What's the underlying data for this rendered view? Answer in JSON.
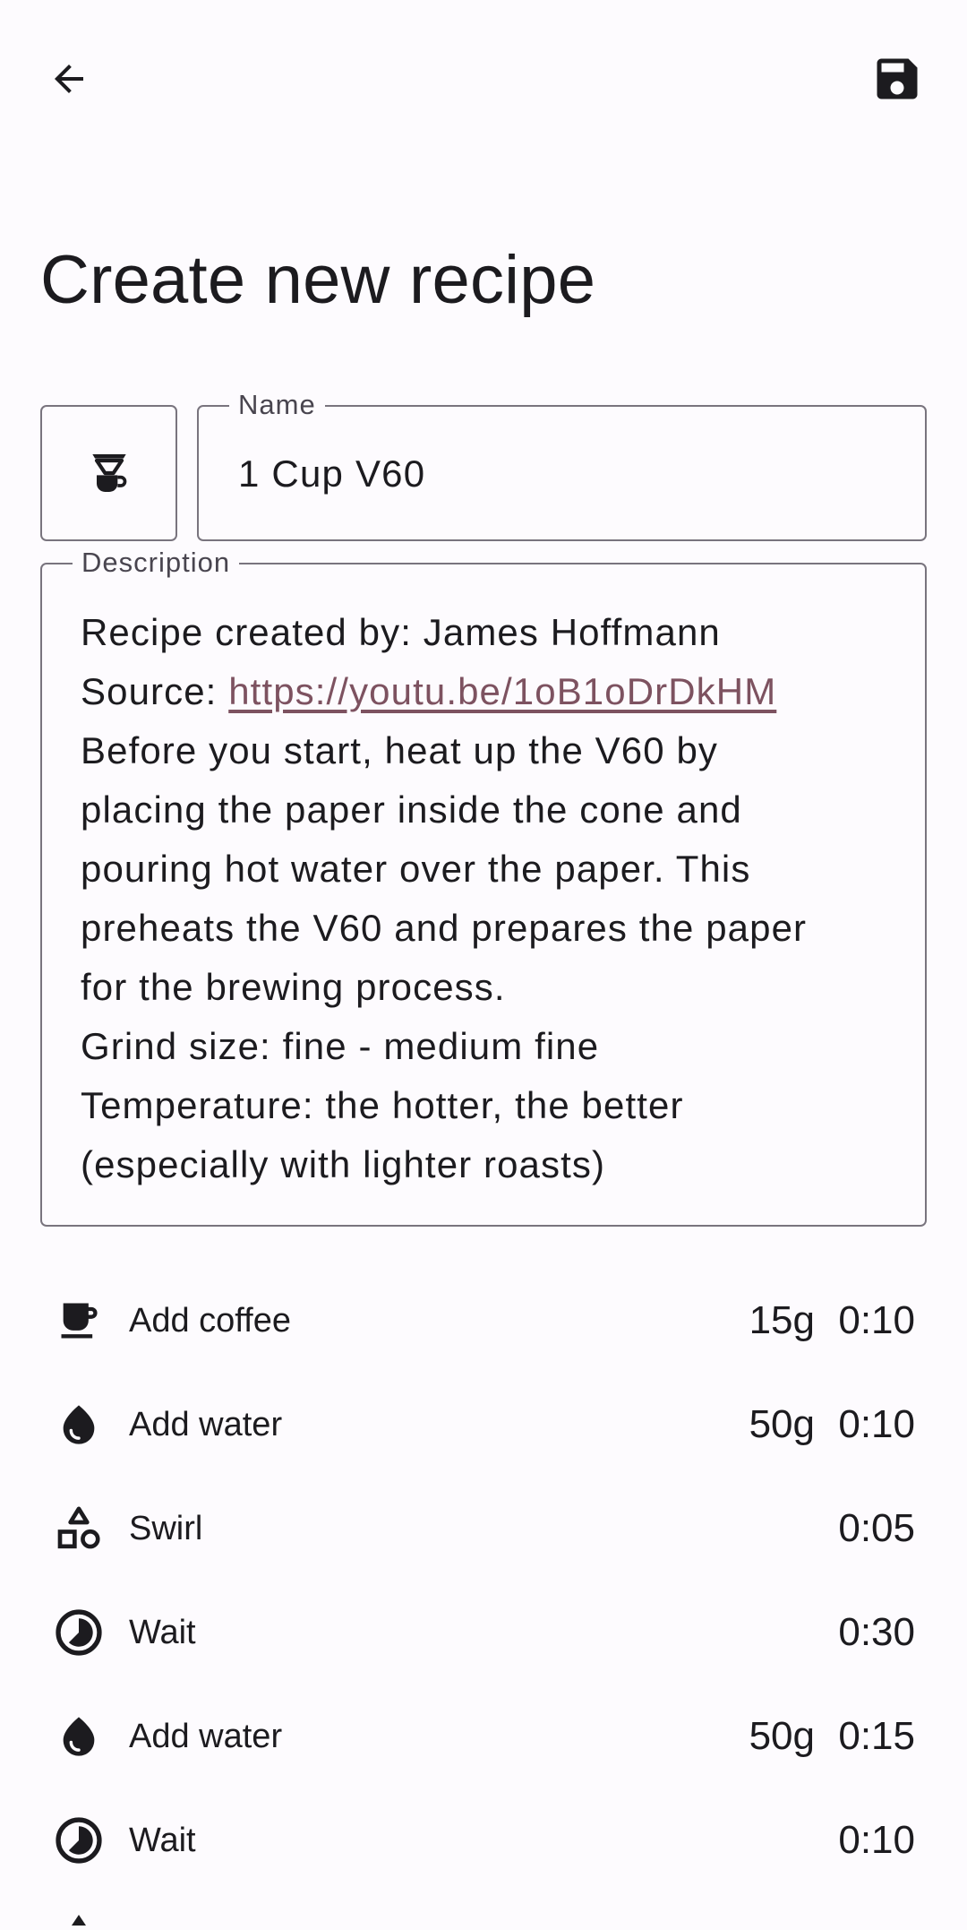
{
  "topbar": {
    "back_icon": "arrow-back-icon",
    "save_icon": "save-floppy-icon"
  },
  "page": {
    "title": "Create new recipe"
  },
  "form": {
    "brewer_icon": "v60-dripper-icon",
    "name_label": "Name",
    "name_value": "1 Cup V60",
    "description_label": "Description",
    "description": {
      "line1": "Recipe created by: James Hoffmann",
      "source_prefix": "Source: ",
      "source_link": "https://youtu.be/1oB1oDrDkHM",
      "line3": "Before you start, heat up the V60 by",
      "line4": "placing the paper inside the cone and",
      "line5": "pouring hot water over the paper. This",
      "line6": "preheats the V60 and prepares the paper",
      "line7": "for the brewing process.",
      "line8": "Grind size: fine - medium fine",
      "line9": "Temperature: the hotter, the better",
      "line10": "(especially with lighter roasts)"
    }
  },
  "steps": [
    {
      "icon": "coffee-cup-icon",
      "label": "Add coffee",
      "amount": "15g",
      "time": "0:10"
    },
    {
      "icon": "water-drop-icon",
      "label": "Add water",
      "amount": "50g",
      "time": "0:10"
    },
    {
      "icon": "shapes-swirl-icon",
      "label": "Swirl",
      "amount": "",
      "time": "0:05"
    },
    {
      "icon": "timer-icon",
      "label": "Wait",
      "amount": "",
      "time": "0:30"
    },
    {
      "icon": "water-drop-icon",
      "label": "Add water",
      "amount": "50g",
      "time": "0:15"
    },
    {
      "icon": "timer-icon",
      "label": "Wait",
      "amount": "",
      "time": "0:10"
    }
  ],
  "colors": {
    "background": "#fdfbfe",
    "text": "#1c1b1f",
    "outline": "#79747e",
    "link": "#7d5260"
  }
}
